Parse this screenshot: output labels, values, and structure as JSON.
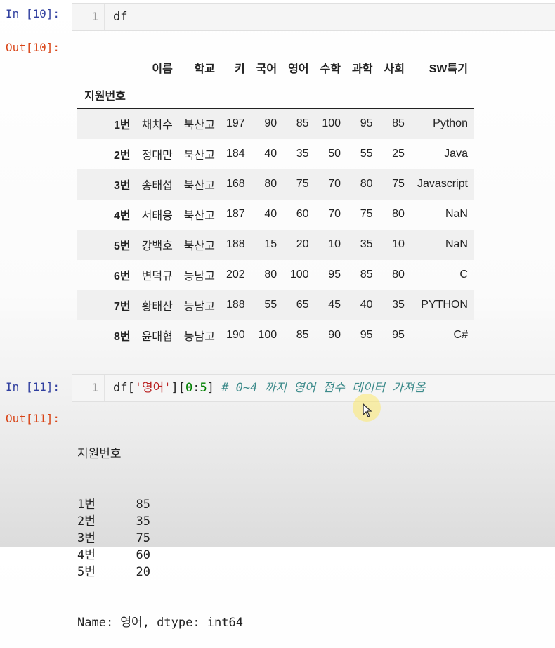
{
  "cells": {
    "c10": {
      "in_prompt": "In [10]:",
      "line_no": "1",
      "code": "df",
      "out_prompt": "Out[10]:"
    },
    "c11": {
      "in_prompt": "In [11]:",
      "line_no": "1",
      "code_parts": [
        "df[",
        "'영어'",
        "][",
        "0",
        ":",
        "5",
        "] ",
        "# 0~4 까지 영어 점수 데이터 가져옴"
      ],
      "out_prompt": "Out[11]:"
    }
  },
  "dataframe": {
    "columns": [
      "이름",
      "학교",
      "키",
      "국어",
      "영어",
      "수학",
      "과학",
      "사회",
      "SW특기"
    ],
    "index_name": "지원번호",
    "rows": [
      {
        "index": "1번",
        "cells": [
          "채치수",
          "북산고",
          "197",
          "90",
          "85",
          "100",
          "95",
          "85",
          "Python"
        ]
      },
      {
        "index": "2번",
        "cells": [
          "정대만",
          "북산고",
          "184",
          "40",
          "35",
          "50",
          "55",
          "25",
          "Java"
        ]
      },
      {
        "index": "3번",
        "cells": [
          "송태섭",
          "북산고",
          "168",
          "80",
          "75",
          "70",
          "80",
          "75",
          "Javascript"
        ]
      },
      {
        "index": "4번",
        "cells": [
          "서태웅",
          "북산고",
          "187",
          "40",
          "60",
          "70",
          "75",
          "80",
          "NaN"
        ]
      },
      {
        "index": "5번",
        "cells": [
          "강백호",
          "북산고",
          "188",
          "15",
          "20",
          "10",
          "35",
          "10",
          "NaN"
        ]
      },
      {
        "index": "6번",
        "cells": [
          "변덕규",
          "능남고",
          "202",
          "80",
          "100",
          "95",
          "85",
          "80",
          "C"
        ]
      },
      {
        "index": "7번",
        "cells": [
          "황태산",
          "능남고",
          "188",
          "55",
          "65",
          "45",
          "40",
          "35",
          "PYTHON"
        ]
      },
      {
        "index": "8번",
        "cells": [
          "윤대협",
          "능남고",
          "190",
          "100",
          "85",
          "90",
          "95",
          "95",
          "C#"
        ]
      }
    ]
  },
  "series": {
    "index_name": "지원번호",
    "rows": [
      {
        "k": "1번",
        "v": "85"
      },
      {
        "k": "2번",
        "v": "35"
      },
      {
        "k": "3번",
        "v": "75"
      },
      {
        "k": "4번",
        "v": "60"
      },
      {
        "k": "5번",
        "v": "20"
      }
    ],
    "footer": "Name: 영어, dtype: int64"
  },
  "icons": {
    "cursor": "mouse-pointer-icon"
  }
}
